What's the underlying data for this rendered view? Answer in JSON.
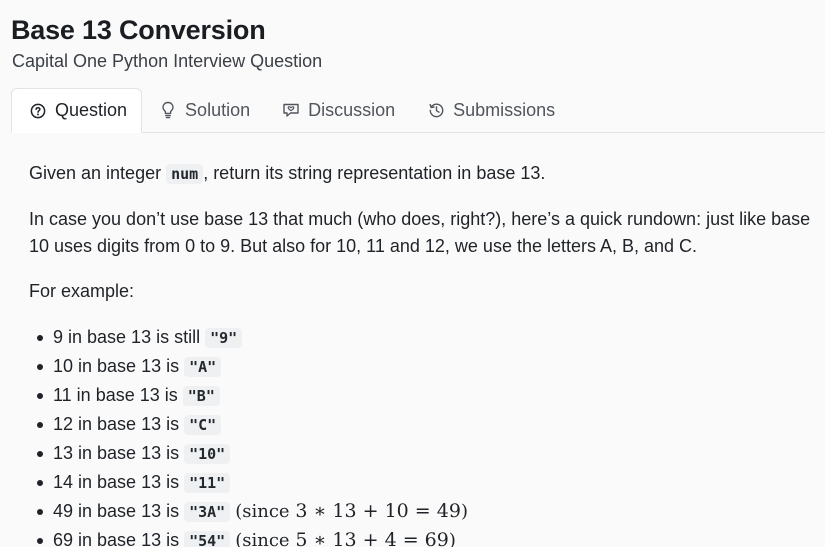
{
  "header": {
    "title": "Base 13 Conversion",
    "subtitle": "Capital One Python Interview Question"
  },
  "tabs": [
    {
      "label": "Question",
      "icon": "question-circle-icon",
      "active": true
    },
    {
      "label": "Solution",
      "icon": "lightbulb-icon",
      "active": false
    },
    {
      "label": "Discussion",
      "icon": "chat-icon",
      "active": false
    },
    {
      "label": "Submissions",
      "icon": "history-icon",
      "active": false
    }
  ],
  "content": {
    "p1_before": "Given an integer ",
    "p1_code": "num",
    "p1_after": ", return its string representation in base 13.",
    "p2": "In case you don’t use base 13 that much (who does, right?), here’s a quick rundown: just like base 10 uses digits from 0 to 9. But also for 10, 11 and 12, we use the letters A, B, and C.",
    "p3": "For example:",
    "examples": [
      {
        "text": "9 in base 13 is still ",
        "code": "\"9\"",
        "note": ""
      },
      {
        "text": "10 in base 13 is ",
        "code": "\"A\"",
        "note": ""
      },
      {
        "text": "11 in base 13 is ",
        "code": "\"B\"",
        "note": ""
      },
      {
        "text": "12 in base 13 is ",
        "code": "\"C\"",
        "note": ""
      },
      {
        "text": "13 in base 13 is ",
        "code": "\"10\"",
        "note": ""
      },
      {
        "text": "14 in base 13 is ",
        "code": "\"11\"",
        "note": ""
      },
      {
        "text": "49 in base 13 is ",
        "code": "\"3A\"",
        "note_open": "(since ",
        "math": "3 ∗ 13 + 10 = 49",
        "note_close": ")"
      },
      {
        "text": "69 in base 13 is ",
        "code": "\"54\"",
        "note_open": "(since ",
        "math": "5 ∗ 13 + 4 = 69",
        "note_close": ")"
      }
    ]
  }
}
